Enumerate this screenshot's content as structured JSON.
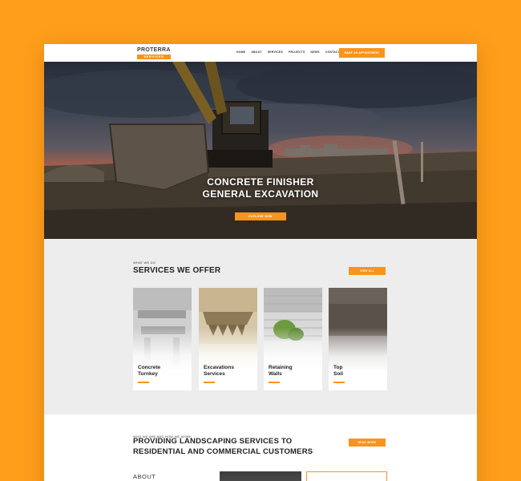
{
  "header": {
    "logo_top": "PROTERRA",
    "logo_bottom": "SERVICES",
    "nav": [
      "HOME",
      "ABOUT",
      "SERVICES",
      "PROJECTS",
      "NEWS",
      "CONTACT"
    ],
    "cta_label": "MAKE AN APPOINTMENT"
  },
  "hero": {
    "title_line1": "CONCRETE FINISHER",
    "title_line2": "GENERAL EXCAVATION",
    "button_label": "EXPLORE NOW"
  },
  "services": {
    "eyebrow": "WHAT WE DO",
    "title": "SERVICES WE OFFER",
    "view_all_label": "VIEW ALL",
    "cards": [
      {
        "line1": "Concrete",
        "line2": "Turnkey"
      },
      {
        "line1": "Excavations",
        "line2": "Services"
      },
      {
        "line1": "Retaining",
        "line2": "Walls"
      },
      {
        "line1": "Top",
        "line2": "Soil"
      }
    ]
  },
  "about": {
    "eyebrow": "WHO WE ARE AND HOW WE WORK",
    "title_line1": "PROVIDING LANDSCAPING SERVICES TO",
    "title_line2": "RESIDENTIAL AND COMMERCIAL CUSTOMERS",
    "read_more_label": "READ MORE",
    "label": "ABOUT"
  },
  "colors": {
    "accent": "#F7941D",
    "background": "#FF9E1B",
    "services_bg": "#EDEDED"
  }
}
